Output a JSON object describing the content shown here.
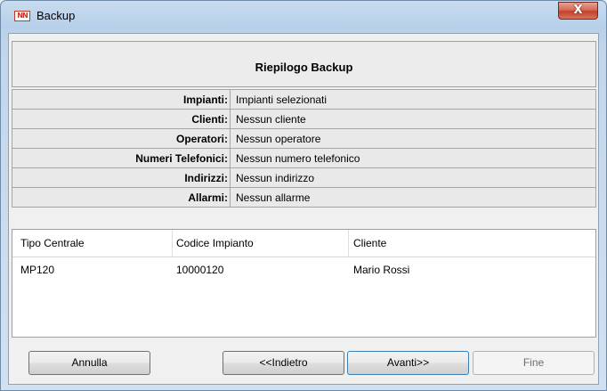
{
  "window": {
    "title": "Backup",
    "icon_text": "NN",
    "close_glyph": "X"
  },
  "header": {
    "title": "Riepilogo Backup"
  },
  "summary": [
    {
      "label": "Impianti:",
      "value": "Impianti selezionati"
    },
    {
      "label": "Clienti:",
      "value": "Nessun cliente"
    },
    {
      "label": "Operatori:",
      "value": "Nessun operatore"
    },
    {
      "label": "Numeri Telefonici:",
      "value": "Nessun numero telefonico"
    },
    {
      "label": "Indirizzi:",
      "value": "Nessun indirizzo"
    },
    {
      "label": "Allarmi:",
      "value": "Nessun allarme"
    }
  ],
  "grid": {
    "columns": [
      "Tipo Centrale",
      "Codice Impianto",
      "Cliente"
    ],
    "rows": [
      [
        "MP120",
        "10000120",
        "Mario Rossi"
      ]
    ]
  },
  "buttons": {
    "cancel": "Annulla",
    "back": "<<Indietro",
    "next": "Avanti>>",
    "finish": "Fine"
  }
}
